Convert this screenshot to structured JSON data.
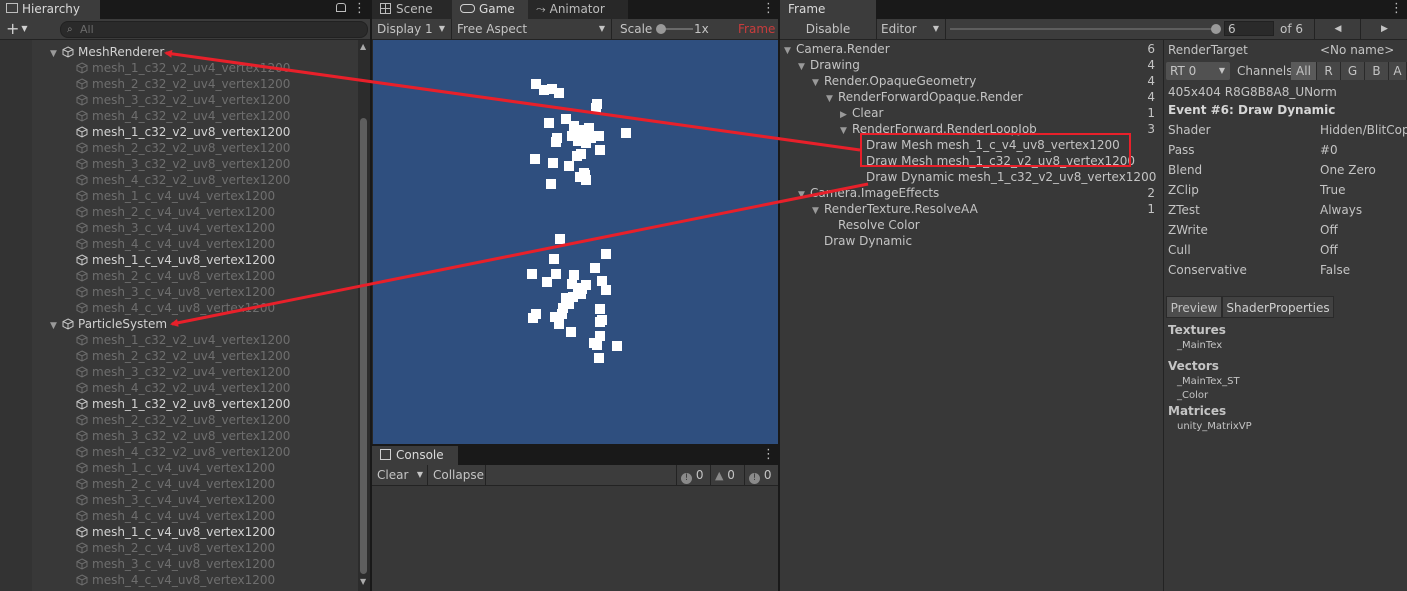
{
  "hierarchy": {
    "tab_label": "Hierarchy",
    "search_placeholder": "All",
    "add_label": "+",
    "mesh_renderer": {
      "label": "MeshRenderer",
      "children": [
        {
          "label": "mesh_1_c32_v2_uv4_vertex1200",
          "active": false
        },
        {
          "label": "mesh_2_c32_v2_uv4_vertex1200",
          "active": false
        },
        {
          "label": "mesh_3_c32_v2_uv4_vertex1200",
          "active": false
        },
        {
          "label": "mesh_4_c32_v2_uv4_vertex1200",
          "active": false
        },
        {
          "label": "mesh_1_c32_v2_uv8_vertex1200",
          "active": true
        },
        {
          "label": "mesh_2_c32_v2_uv8_vertex1200",
          "active": false
        },
        {
          "label": "mesh_3_c32_v2_uv8_vertex1200",
          "active": false
        },
        {
          "label": "mesh_4_c32_v2_uv8_vertex1200",
          "active": false
        },
        {
          "label": "mesh_1_c_v4_uv4_vertex1200",
          "active": false
        },
        {
          "label": "mesh_2_c_v4_uv4_vertex1200",
          "active": false
        },
        {
          "label": "mesh_3_c_v4_uv4_vertex1200",
          "active": false
        },
        {
          "label": "mesh_4_c_v4_uv4_vertex1200",
          "active": false
        },
        {
          "label": "mesh_1_c_v4_uv8_vertex1200",
          "active": true
        },
        {
          "label": "mesh_2_c_v4_uv8_vertex1200",
          "active": false
        },
        {
          "label": "mesh_3_c_v4_uv8_vertex1200",
          "active": false
        },
        {
          "label": "mesh_4_c_v4_uv8_vertex1200",
          "active": false
        }
      ]
    },
    "particle_system": {
      "label": "ParticleSystem",
      "children": [
        {
          "label": "mesh_1_c32_v2_uv4_vertex1200",
          "active": false
        },
        {
          "label": "mesh_2_c32_v2_uv4_vertex1200",
          "active": false
        },
        {
          "label": "mesh_3_c32_v2_uv4_vertex1200",
          "active": false
        },
        {
          "label": "mesh_4_c32_v2_uv4_vertex1200",
          "active": false
        },
        {
          "label": "mesh_1_c32_v2_uv8_vertex1200",
          "active": true
        },
        {
          "label": "mesh_2_c32_v2_uv8_vertex1200",
          "active": false
        },
        {
          "label": "mesh_3_c32_v2_uv8_vertex1200",
          "active": false
        },
        {
          "label": "mesh_4_c32_v2_uv8_vertex1200",
          "active": false
        },
        {
          "label": "mesh_1_c_v4_uv4_vertex1200",
          "active": false
        },
        {
          "label": "mesh_2_c_v4_uv4_vertex1200",
          "active": false
        },
        {
          "label": "mesh_3_c_v4_uv4_vertex1200",
          "active": false
        },
        {
          "label": "mesh_4_c_v4_uv4_vertex1200",
          "active": false
        },
        {
          "label": "mesh_1_c_v4_uv8_vertex1200",
          "active": true
        },
        {
          "label": "mesh_2_c_v4_uv8_vertex1200",
          "active": false
        },
        {
          "label": "mesh_3_c_v4_uv8_vertex1200",
          "active": false
        },
        {
          "label": "mesh_4_c_v4_uv8_vertex1200",
          "active": false
        }
      ]
    }
  },
  "game": {
    "tabs": {
      "scene": "Scene",
      "game": "Game",
      "animator": "Animator"
    },
    "display": "Display 1",
    "aspect": "Free Aspect",
    "scale_label": "Scale",
    "scale_value": "1x",
    "frame_label": "Frame",
    "background_color": "#2f4f7f"
  },
  "console": {
    "tab_label": "Console",
    "clear_label": "Clear",
    "collapse_label": "Collapse",
    "info_count": "0",
    "warn_count": "0",
    "error_count": "0"
  },
  "frame_debug": {
    "tab_label": "Frame Debug",
    "disable_label": "Disable",
    "target": "Editor",
    "current_event": "6",
    "of_label": "of 6",
    "slider_fraction": 1.0,
    "tree": [
      {
        "label": "Camera.Render",
        "count": "6",
        "depth": 0,
        "tri": "down"
      },
      {
        "label": "Drawing",
        "count": "4",
        "depth": 1,
        "tri": "down"
      },
      {
        "label": "Render.OpaqueGeometry",
        "count": "4",
        "depth": 2,
        "tri": "down"
      },
      {
        "label": "RenderForwardOpaque.Render",
        "count": "4",
        "depth": 3,
        "tri": "down"
      },
      {
        "label": "Clear",
        "count": "1",
        "depth": 4,
        "tri": "right"
      },
      {
        "label": "RenderForward.RenderLoopJob",
        "count": "3",
        "depth": 4,
        "tri": "down"
      },
      {
        "label": "Draw Mesh mesh_1_c_v4_uv8_vertex1200",
        "count": "",
        "depth": 5,
        "tri": ""
      },
      {
        "label": "Draw Mesh mesh_1_c32_v2_uv8_vertex1200",
        "count": "",
        "depth": 5,
        "tri": ""
      },
      {
        "label": "Draw Dynamic mesh_1_c32_v2_uv8_vertex1200",
        "count": "",
        "depth": 5,
        "tri": ""
      },
      {
        "label": "Camera.ImageEffects",
        "count": "2",
        "depth": 1,
        "tri": "down"
      },
      {
        "label": "RenderTexture.ResolveAA",
        "count": "1",
        "depth": 2,
        "tri": "down"
      },
      {
        "label": "Resolve Color",
        "count": "",
        "depth": 3,
        "tri": ""
      },
      {
        "label": "Draw Dynamic",
        "count": "",
        "depth": 2,
        "tri": ""
      }
    ],
    "details": {
      "render_target_label": "RenderTarget",
      "render_target_value": "<No name>",
      "rt_select": "RT 0",
      "channels_label": "Channels",
      "channels": [
        "All",
        "R",
        "G",
        "B",
        "A"
      ],
      "format": "405x404 R8G8B8A8_UNorm",
      "event_title": "Event #6: Draw Dynamic",
      "properties": [
        {
          "label": "Shader",
          "value": "Hidden/BlitCopy"
        },
        {
          "label": "Pass",
          "value": "#0"
        },
        {
          "label": "Blend",
          "value": "One Zero"
        },
        {
          "label": "ZClip",
          "value": "True"
        },
        {
          "label": "ZTest",
          "value": "Always"
        },
        {
          "label": "ZWrite",
          "value": "Off"
        },
        {
          "label": "Cull",
          "value": "Off"
        },
        {
          "label": "Conservative",
          "value": "False"
        }
      ],
      "preview_tab": "Preview",
      "shader_props_tab": "ShaderProperties",
      "textures_heading": "Textures",
      "textures": [
        "_MainTex"
      ],
      "vectors_heading": "Vectors",
      "vectors": [
        "_MainTex_ST",
        "_Color"
      ],
      "matrices_heading": "Matrices",
      "matrices": [
        "unity_MatrixVP"
      ]
    }
  },
  "annotation_color": "#e8202a"
}
